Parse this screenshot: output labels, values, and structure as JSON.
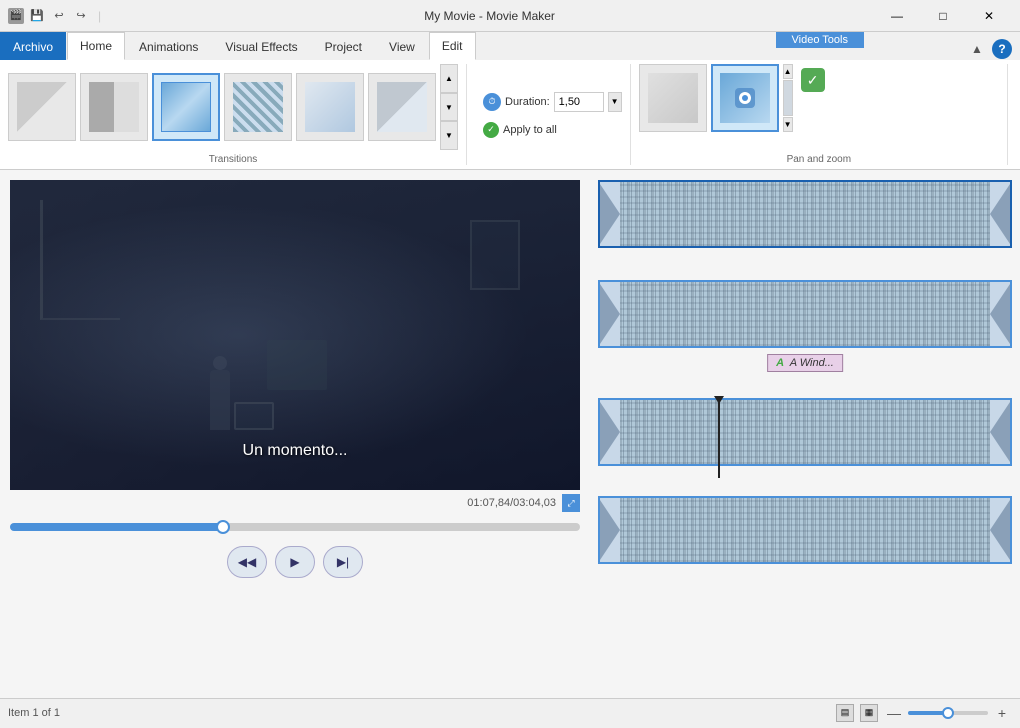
{
  "titlebar": {
    "title": "My Movie - Movie Maker",
    "minimize": "—",
    "maximize": "□",
    "close": "✕"
  },
  "quickaccess": {
    "save": "💾",
    "undo": "↩",
    "redo": "↪",
    "separator": "|"
  },
  "tabs": {
    "archivo": "Archivo",
    "home": "Home",
    "animations": "Animations",
    "visual_effects": "Visual Effects",
    "project": "Project",
    "view": "View",
    "edit": "Edit",
    "video_tools": "Video Tools"
  },
  "ribbon": {
    "transitions_label": "Transitions",
    "panzoom_label": "Pan and zoom",
    "duration_label": "Duration:",
    "duration_value": "1,50",
    "apply_to_all": "Apply to all",
    "scroll_up": "▲",
    "scroll_down": "▼",
    "scroll_more": "▼"
  },
  "preview": {
    "timecode": "01:07,84/03:04,03",
    "subtitle": "Un momento...",
    "slider_pct": 37
  },
  "playback": {
    "rewind": "◀◀",
    "play": "▶",
    "step": "▶|"
  },
  "timeline": {
    "clips": [
      {
        "id": 1,
        "label": "",
        "has_text": false,
        "playhead": false
      },
      {
        "id": 2,
        "label": "A Wind...",
        "has_text": true,
        "playhead": false
      },
      {
        "id": 3,
        "label": "",
        "has_text": false,
        "playhead": true
      },
      {
        "id": 4,
        "label": "",
        "has_text": false,
        "playhead": false
      }
    ]
  },
  "statusbar": {
    "item_info": "Item 1 of 1",
    "zoom_minus": "—",
    "zoom_plus": "+"
  },
  "icons": {
    "duration_clock": "⏱",
    "apply_check": "✓",
    "fullscreen": "⤢",
    "help": "?",
    "collapse": "▲",
    "save_file": "💾",
    "app_icon": "🎬",
    "timeline_view": "▦",
    "storyboard_view": "▤"
  }
}
